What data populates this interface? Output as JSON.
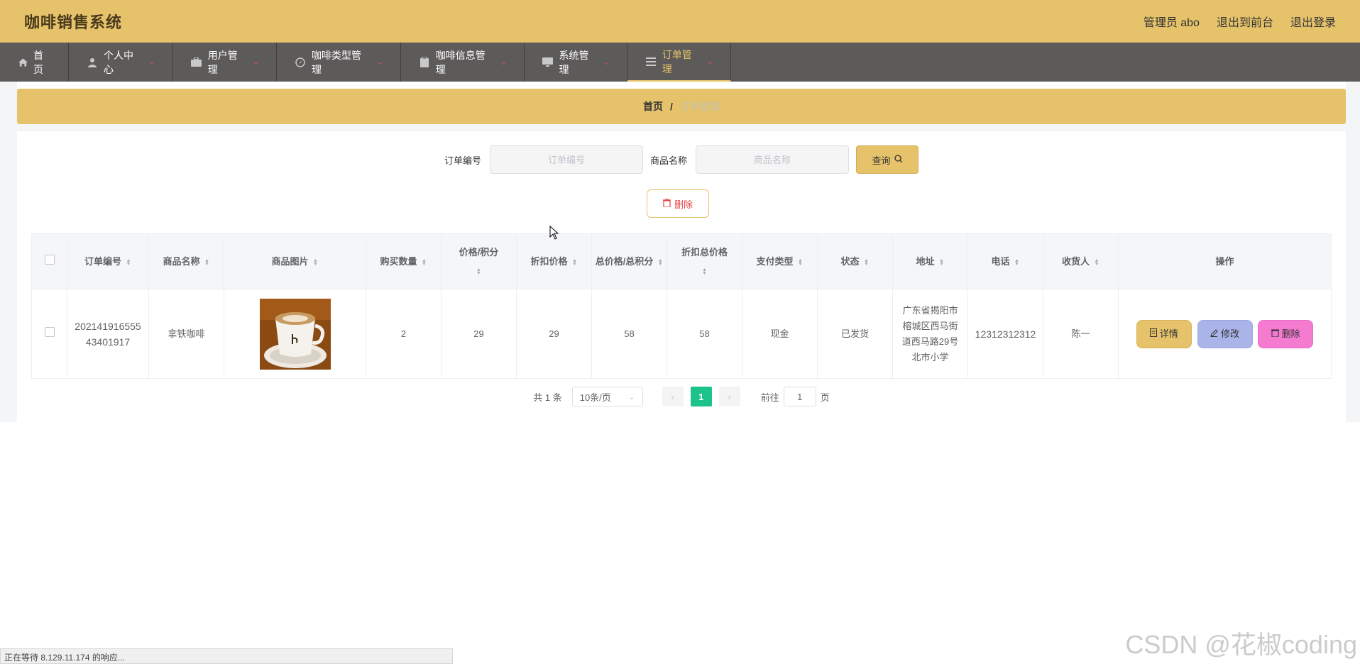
{
  "header": {
    "title": "咖啡销售系统",
    "links": [
      "管理员 abo",
      "退出到前台",
      "退出登录"
    ]
  },
  "nav": [
    {
      "label": "首页",
      "icon": "home-icon",
      "dropdown": false
    },
    {
      "label": "个人中心",
      "icon": "user-icon",
      "dropdown": true
    },
    {
      "label": "用户管理",
      "icon": "briefcase-icon",
      "dropdown": true
    },
    {
      "label": "咖啡类型管理",
      "icon": "compass-icon",
      "dropdown": true
    },
    {
      "label": "咖啡信息管理",
      "icon": "clipboard-icon",
      "dropdown": true
    },
    {
      "label": "系统管理",
      "icon": "monitor-icon",
      "dropdown": true
    },
    {
      "label": "订单管理",
      "icon": "list-icon",
      "dropdown": true,
      "active": true
    }
  ],
  "breadcrumb": {
    "home": "首页",
    "separator": "/",
    "current": "订单管理"
  },
  "search": {
    "order_label": "订单编号",
    "order_placeholder": "订单编号",
    "product_label": "商品名称",
    "product_placeholder": "商品名称",
    "query_button": "查询"
  },
  "delete_button": "删除",
  "table": {
    "headers": [
      "订单编号",
      "商品名称",
      "商品图片",
      "购买数量",
      "价格/积分",
      "折扣价格",
      "总价格/总积分",
      "折扣总价格",
      "支付类型",
      "状态",
      "地址",
      "电话",
      "收货人",
      "操作"
    ],
    "rows": [
      {
        "order_no": "20214191655543401917",
        "product_name": "拿铁咖啡",
        "quantity": "2",
        "price": "29",
        "discount_price": "29",
        "total_price": "58",
        "discount_total": "58",
        "pay_type": "现金",
        "status": "已发货",
        "address": "广东省揭阳市榕城区西马街道西马路29号北市小学",
        "phone": "12312312312",
        "receiver": "陈一",
        "actions": {
          "detail": "详情",
          "edit": "修改",
          "delete": "删除"
        }
      }
    ]
  },
  "pagination": {
    "total": "共 1 条",
    "page_size": "10条/页",
    "current_page": "1",
    "goto_prefix": "前往",
    "goto_value": "1",
    "goto_suffix": "页"
  },
  "status_bar": "正在等待 8.129.11.174 的响应...",
  "watermark": "CSDN @花椒coding",
  "colors": {
    "accent": "#e6c36b",
    "nav": "#5d5a5a",
    "page_active": "#1ec28b"
  }
}
